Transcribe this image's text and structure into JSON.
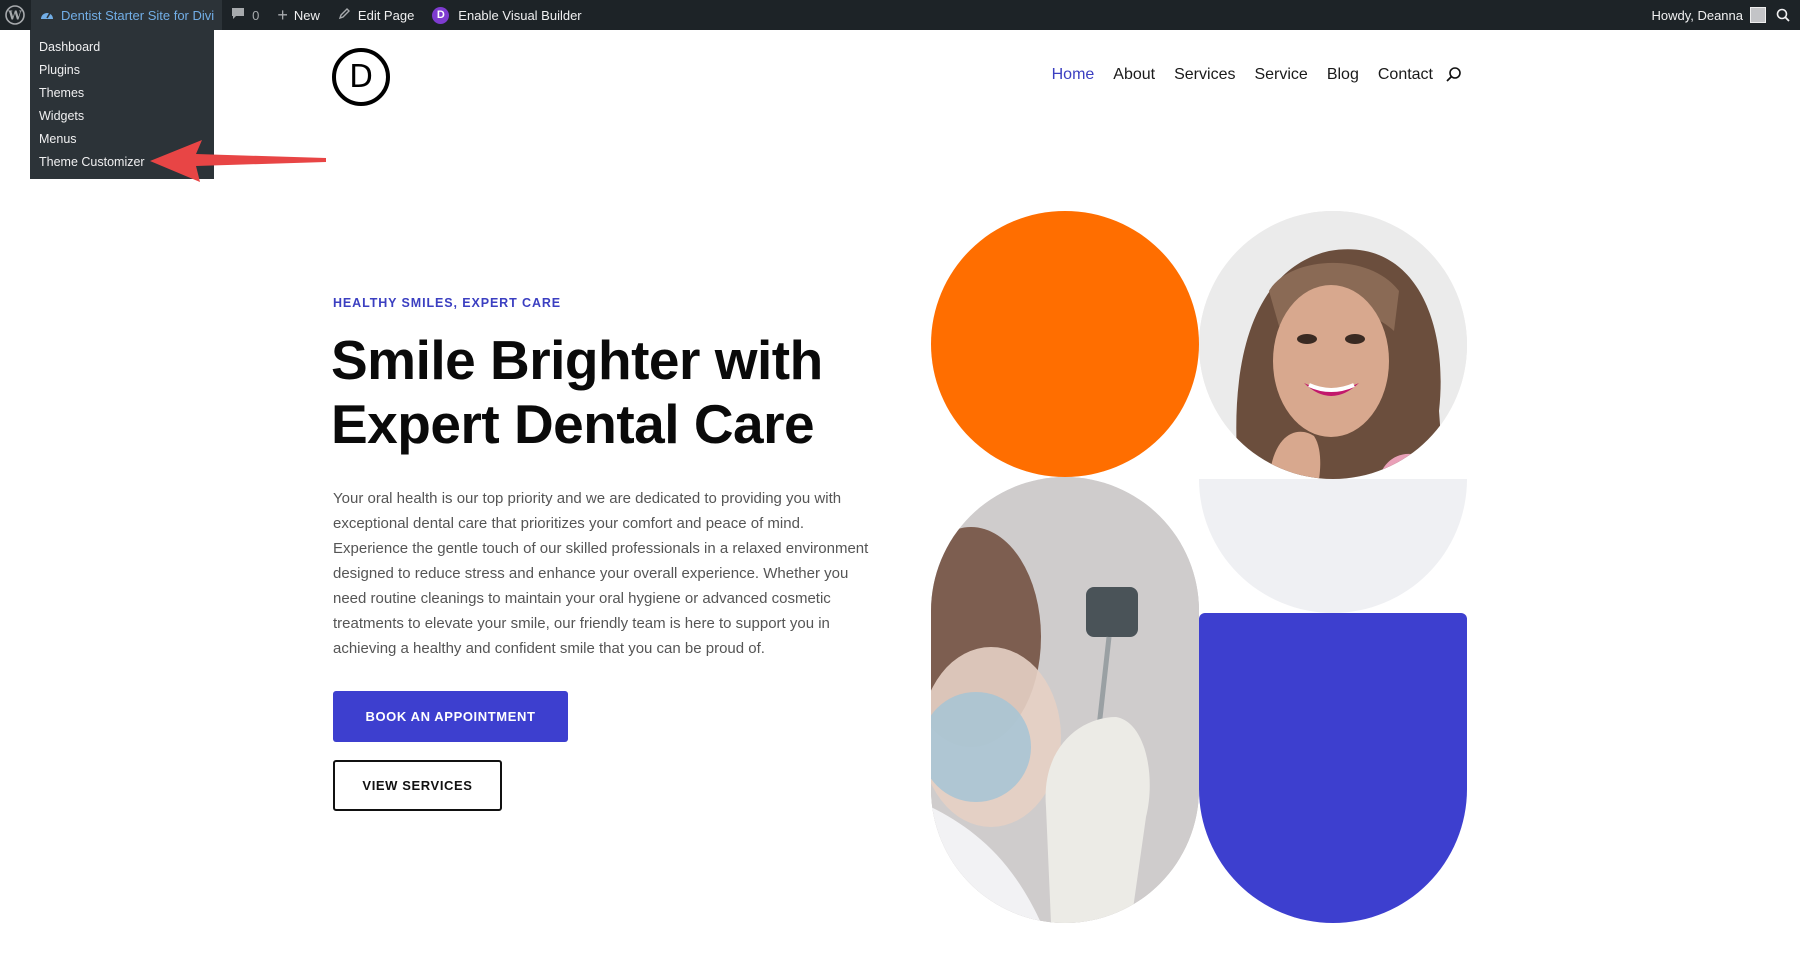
{
  "admin_bar": {
    "site_name": "Dentist Starter Site for Divi",
    "comments_count": "0",
    "new_label": "New",
    "edit_page_label": "Edit Page",
    "visual_builder_label": "Enable Visual Builder",
    "greeting": "Howdy, Deanna"
  },
  "site_menu": {
    "items": [
      "Dashboard",
      "Plugins",
      "Themes",
      "Widgets",
      "Menus",
      "Theme Customizer"
    ]
  },
  "annotation": {
    "arrow_color": "#e84545",
    "target": "Theme Customizer"
  },
  "header": {
    "logo_letter": "D",
    "nav": [
      "Home",
      "About",
      "Services",
      "Service",
      "Blog",
      "Contact"
    ],
    "active_nav": "Home"
  },
  "hero": {
    "eyebrow": "HEALTHY SMILES, EXPERT CARE",
    "headline_line1": "Smile Brighter with",
    "headline_line2": "Expert Dental Care",
    "body": "Your oral health is our top priority and we are dedicated to providing you with exceptional dental care that prioritizes your comfort and peace of mind. Experience the gentle touch of our skilled professionals in a relaxed environment designed to reduce stress and enhance your overall experience. Whether you need routine cleanings to maintain your oral hygiene or advanced cosmetic treatments to elevate your smile, our friendly team is here to support you in achieving a healthy and confident smile that you can be proud of.",
    "primary_button": "BOOK AN APPOINTMENT",
    "secondary_button": "VIEW SERVICES"
  },
  "colors": {
    "accent_blue": "#3d3fcf",
    "orange": "#ff6e00",
    "admin_bar_bg": "#1d2327"
  }
}
